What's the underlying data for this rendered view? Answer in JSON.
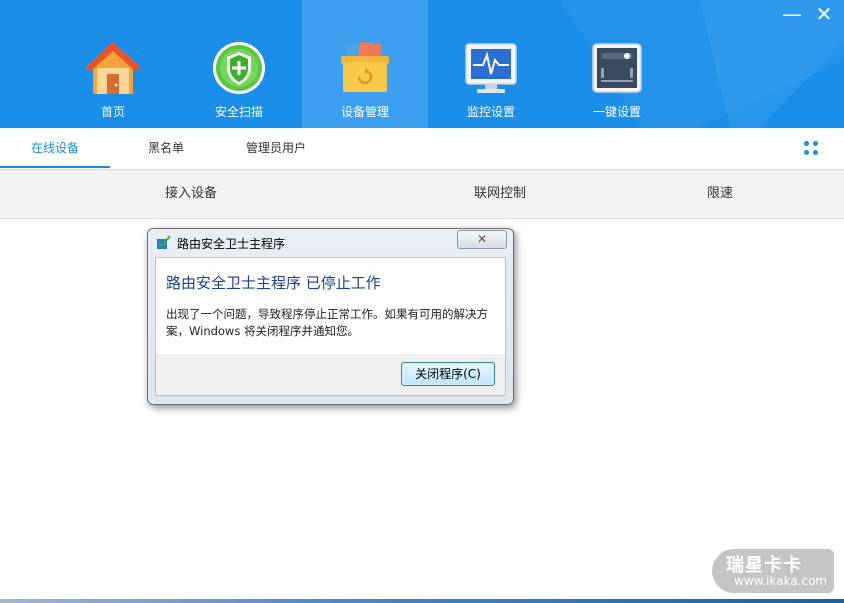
{
  "window": {
    "minimize_label": "—",
    "close_label": "✕"
  },
  "nav": {
    "items": [
      {
        "label": "首页",
        "icon": "home-icon"
      },
      {
        "label": "安全扫描",
        "icon": "shield-icon"
      },
      {
        "label": "设备管理",
        "icon": "device-box-icon",
        "active": true
      },
      {
        "label": "监控设置",
        "icon": "monitor-icon"
      },
      {
        "label": "一键设置",
        "icon": "router-settings-icon"
      }
    ]
  },
  "tabs": {
    "items": [
      {
        "label": "在线设备",
        "active": true
      },
      {
        "label": "黑名单"
      },
      {
        "label": "管理员用户"
      }
    ]
  },
  "table": {
    "columns": [
      "接入设备",
      "联网控制",
      "限速"
    ]
  },
  "dialog": {
    "title": "路由安全卫士主程序",
    "close_label": "✕",
    "heading": "路由安全卫士主程序 已停止工作",
    "message": "出现了一个问题，导致程序停止正常工作。如果有可用的解决方案，Windows 将关闭程序并通知您。",
    "button_label": "关闭程序(C)"
  },
  "watermark": {
    "logo": "瑞星卡卡",
    "url": "www.ikaka.com"
  },
  "colors": {
    "header_blue": "#1b8ee9",
    "active_tab": "#1b8ee9",
    "dialog_heading": "#1e3f9a"
  }
}
